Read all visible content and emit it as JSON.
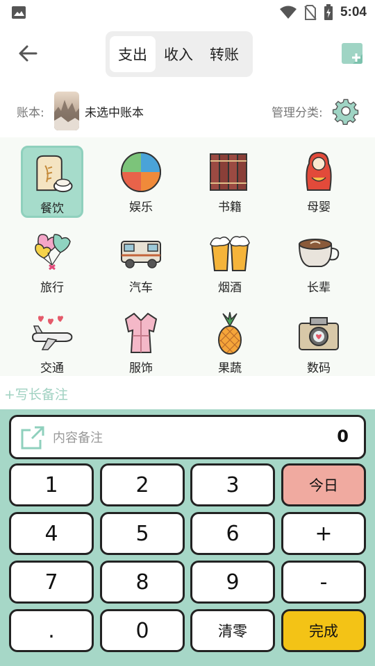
{
  "status_bar": {
    "time": "5:04"
  },
  "header": {
    "tabs": [
      {
        "label": "支出",
        "active": true
      },
      {
        "label": "收入",
        "active": false
      },
      {
        "label": "转账",
        "active": false
      }
    ]
  },
  "ledger": {
    "label": "账本:",
    "name": "未选中账本",
    "manage_label": "管理分类:"
  },
  "categories": [
    {
      "label": "餐饮",
      "icon": "food-icon",
      "selected": true
    },
    {
      "label": "娱乐",
      "icon": "beach-ball-icon",
      "selected": false
    },
    {
      "label": "书籍",
      "icon": "books-icon",
      "selected": false
    },
    {
      "label": "母婴",
      "icon": "matryoshka-icon",
      "selected": false
    },
    {
      "label": "旅行",
      "icon": "balloons-icon",
      "selected": false
    },
    {
      "label": "汽车",
      "icon": "camper-van-icon",
      "selected": false
    },
    {
      "label": "烟酒",
      "icon": "beer-icon",
      "selected": false
    },
    {
      "label": "长辈",
      "icon": "coffee-cup-icon",
      "selected": false
    },
    {
      "label": "交通",
      "icon": "airplane-icon",
      "selected": false
    },
    {
      "label": "服饰",
      "icon": "robe-icon",
      "selected": false
    },
    {
      "label": "果蔬",
      "icon": "pineapple-icon",
      "selected": false
    },
    {
      "label": "数码",
      "icon": "camera-icon",
      "selected": false
    }
  ],
  "long_note": "+写长备注",
  "memo": {
    "placeholder": "内容备注",
    "amount": "0"
  },
  "keys": {
    "k1": "1",
    "k2": "2",
    "k3": "3",
    "today": "今日",
    "k4": "4",
    "k5": "5",
    "k6": "6",
    "plus": "+",
    "k7": "7",
    "k8": "8",
    "k9": "9",
    "minus": "-",
    "dot": ".",
    "k0": "0",
    "clear": "清零",
    "done": "完成"
  },
  "colors": {
    "accent": "#a6d7c7",
    "selected_category": "#a6dccb",
    "today_key": "#f0aaa0",
    "done_key": "#f3c316"
  }
}
